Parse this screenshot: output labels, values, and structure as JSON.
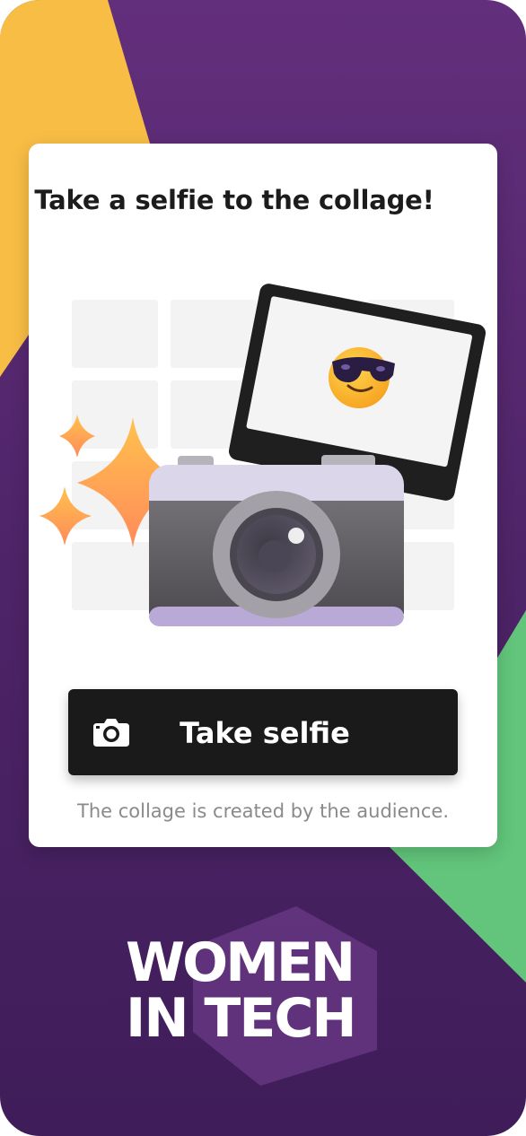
{
  "card": {
    "title": "Take a selfie to the collage!",
    "footnote": "The collage is created by the audience."
  },
  "selfie_button": {
    "label": "Take selfie",
    "icon": "camera-icon"
  },
  "illustration": {
    "icon": "camera-with-photo-illustration",
    "emoji": "smiling-face-with-sunglasses"
  },
  "logo": {
    "line1": "WOMEN",
    "line2": "IN TECH"
  },
  "colors": {
    "background": "#632f7c",
    "accent_yellow": "#f8bd45",
    "accent_green": "#62c57b",
    "button": "#1a1a1a",
    "card": "#ffffff"
  }
}
